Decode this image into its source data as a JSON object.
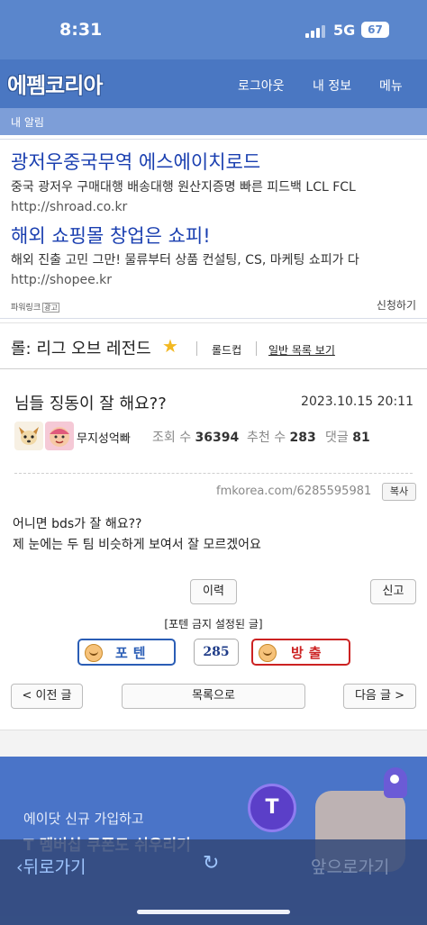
{
  "status_bar": {
    "time": "8:31",
    "network": "5G",
    "battery": "67"
  },
  "header": {
    "logo": "에펨코리아",
    "nav": [
      "로그아웃",
      "내 정보",
      "메뉴"
    ],
    "sub_link": "내 알림"
  },
  "ads": {
    "items": [
      {
        "title": "광저우중국무역 에스에이치로드",
        "desc": "중국 광저우 구매대행 배송대행 원산지증명 빠른 피드백 LCL FCL",
        "url": "http://shroad.co.kr"
      },
      {
        "title": "해외 쇼핑몰 창업은 쇼피!",
        "desc": "해외 진출 고민 그만! 물류부터 상품 컨설팅, CS, 마케팅 쇼피가 다",
        "url": "http://shopee.kr"
      }
    ],
    "powerlink_label": "파워링크",
    "ad_tag": "광고",
    "apply_label": "신청하기"
  },
  "board": {
    "title": "롤: 리그 오브 레전드",
    "links": [
      "롤드컵",
      "일반 목록 보기"
    ]
  },
  "post": {
    "title": "님들 징동이 잘 해요??",
    "date": "2023.10.15 20:11",
    "author": "무지성억빠",
    "views_label": "조회 수",
    "views": "36394",
    "recommend_label": "추천 수",
    "recommend": "283",
    "comments_label": "댓글",
    "comments": "81",
    "url": "fmkorea.com/6285595981",
    "copy_label": "복사",
    "body": [
      "어니면 bds가 잘 해요??",
      "제 눈에는 두 팀 비슷하게 보여서 잘 모르겠어요"
    ]
  },
  "actions": {
    "history": "이력",
    "report": "신고",
    "notice": "[포텐 금지 설정된 글]",
    "vote_up": "포텐",
    "vote_count": "285",
    "vote_down": "방출"
  },
  "pager": {
    "prev": "< 이전 글",
    "list": "목록으로",
    "next": "다음 글 >"
  },
  "banner": {
    "line1": "에이닷 신규 가입하고",
    "line2": "T 멤버십 쿠폰도 쉬우리기"
  },
  "browser": {
    "back": "뒤로가기",
    "forward": "앞으로가기"
  },
  "colors": {
    "header": "#4a77c2",
    "link_blue": "#1a3fb0",
    "vote_up": "#2a5db5",
    "vote_down": "#cc2222"
  }
}
